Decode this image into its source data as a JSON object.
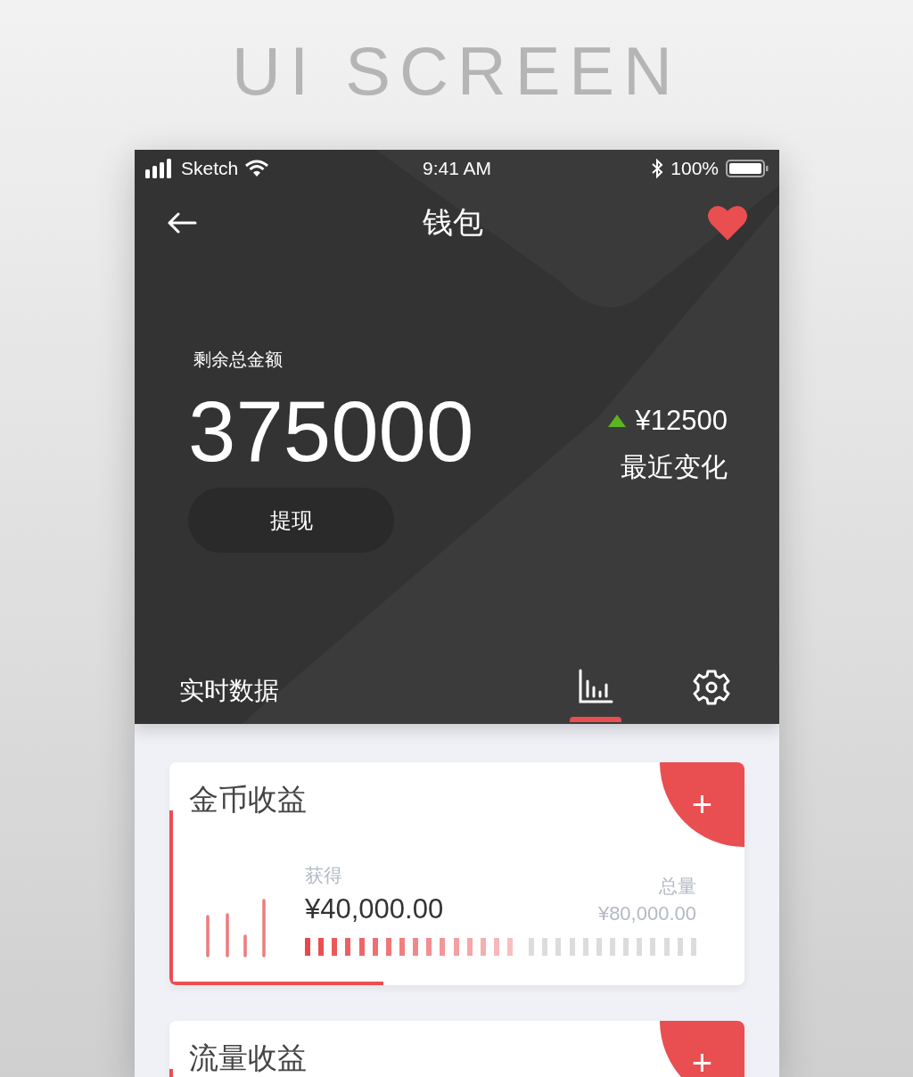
{
  "heading": "UI SCREEN",
  "status_bar": {
    "carrier": "Sketch",
    "time": "9:41 AM",
    "battery": "100%"
  },
  "nav": {
    "title": "钱包",
    "favorite": true
  },
  "balance": {
    "label": "剩余总金额",
    "amount": "375000",
    "action": "提现",
    "change": "¥12500",
    "change_label": "最近变化"
  },
  "section": {
    "title": "实时数据"
  },
  "tabs": [
    {
      "kind": "chart",
      "selected": true
    },
    {
      "kind": "settings",
      "selected": false
    }
  ],
  "cards": [
    {
      "title": "金币收益",
      "add": "+",
      "earned_label": "获得",
      "earned": "¥40,000.00",
      "total_label": "总量",
      "total": "¥80,000.00",
      "level": 0.55
    },
    {
      "title": "流量收益",
      "add": "+"
    }
  ]
}
